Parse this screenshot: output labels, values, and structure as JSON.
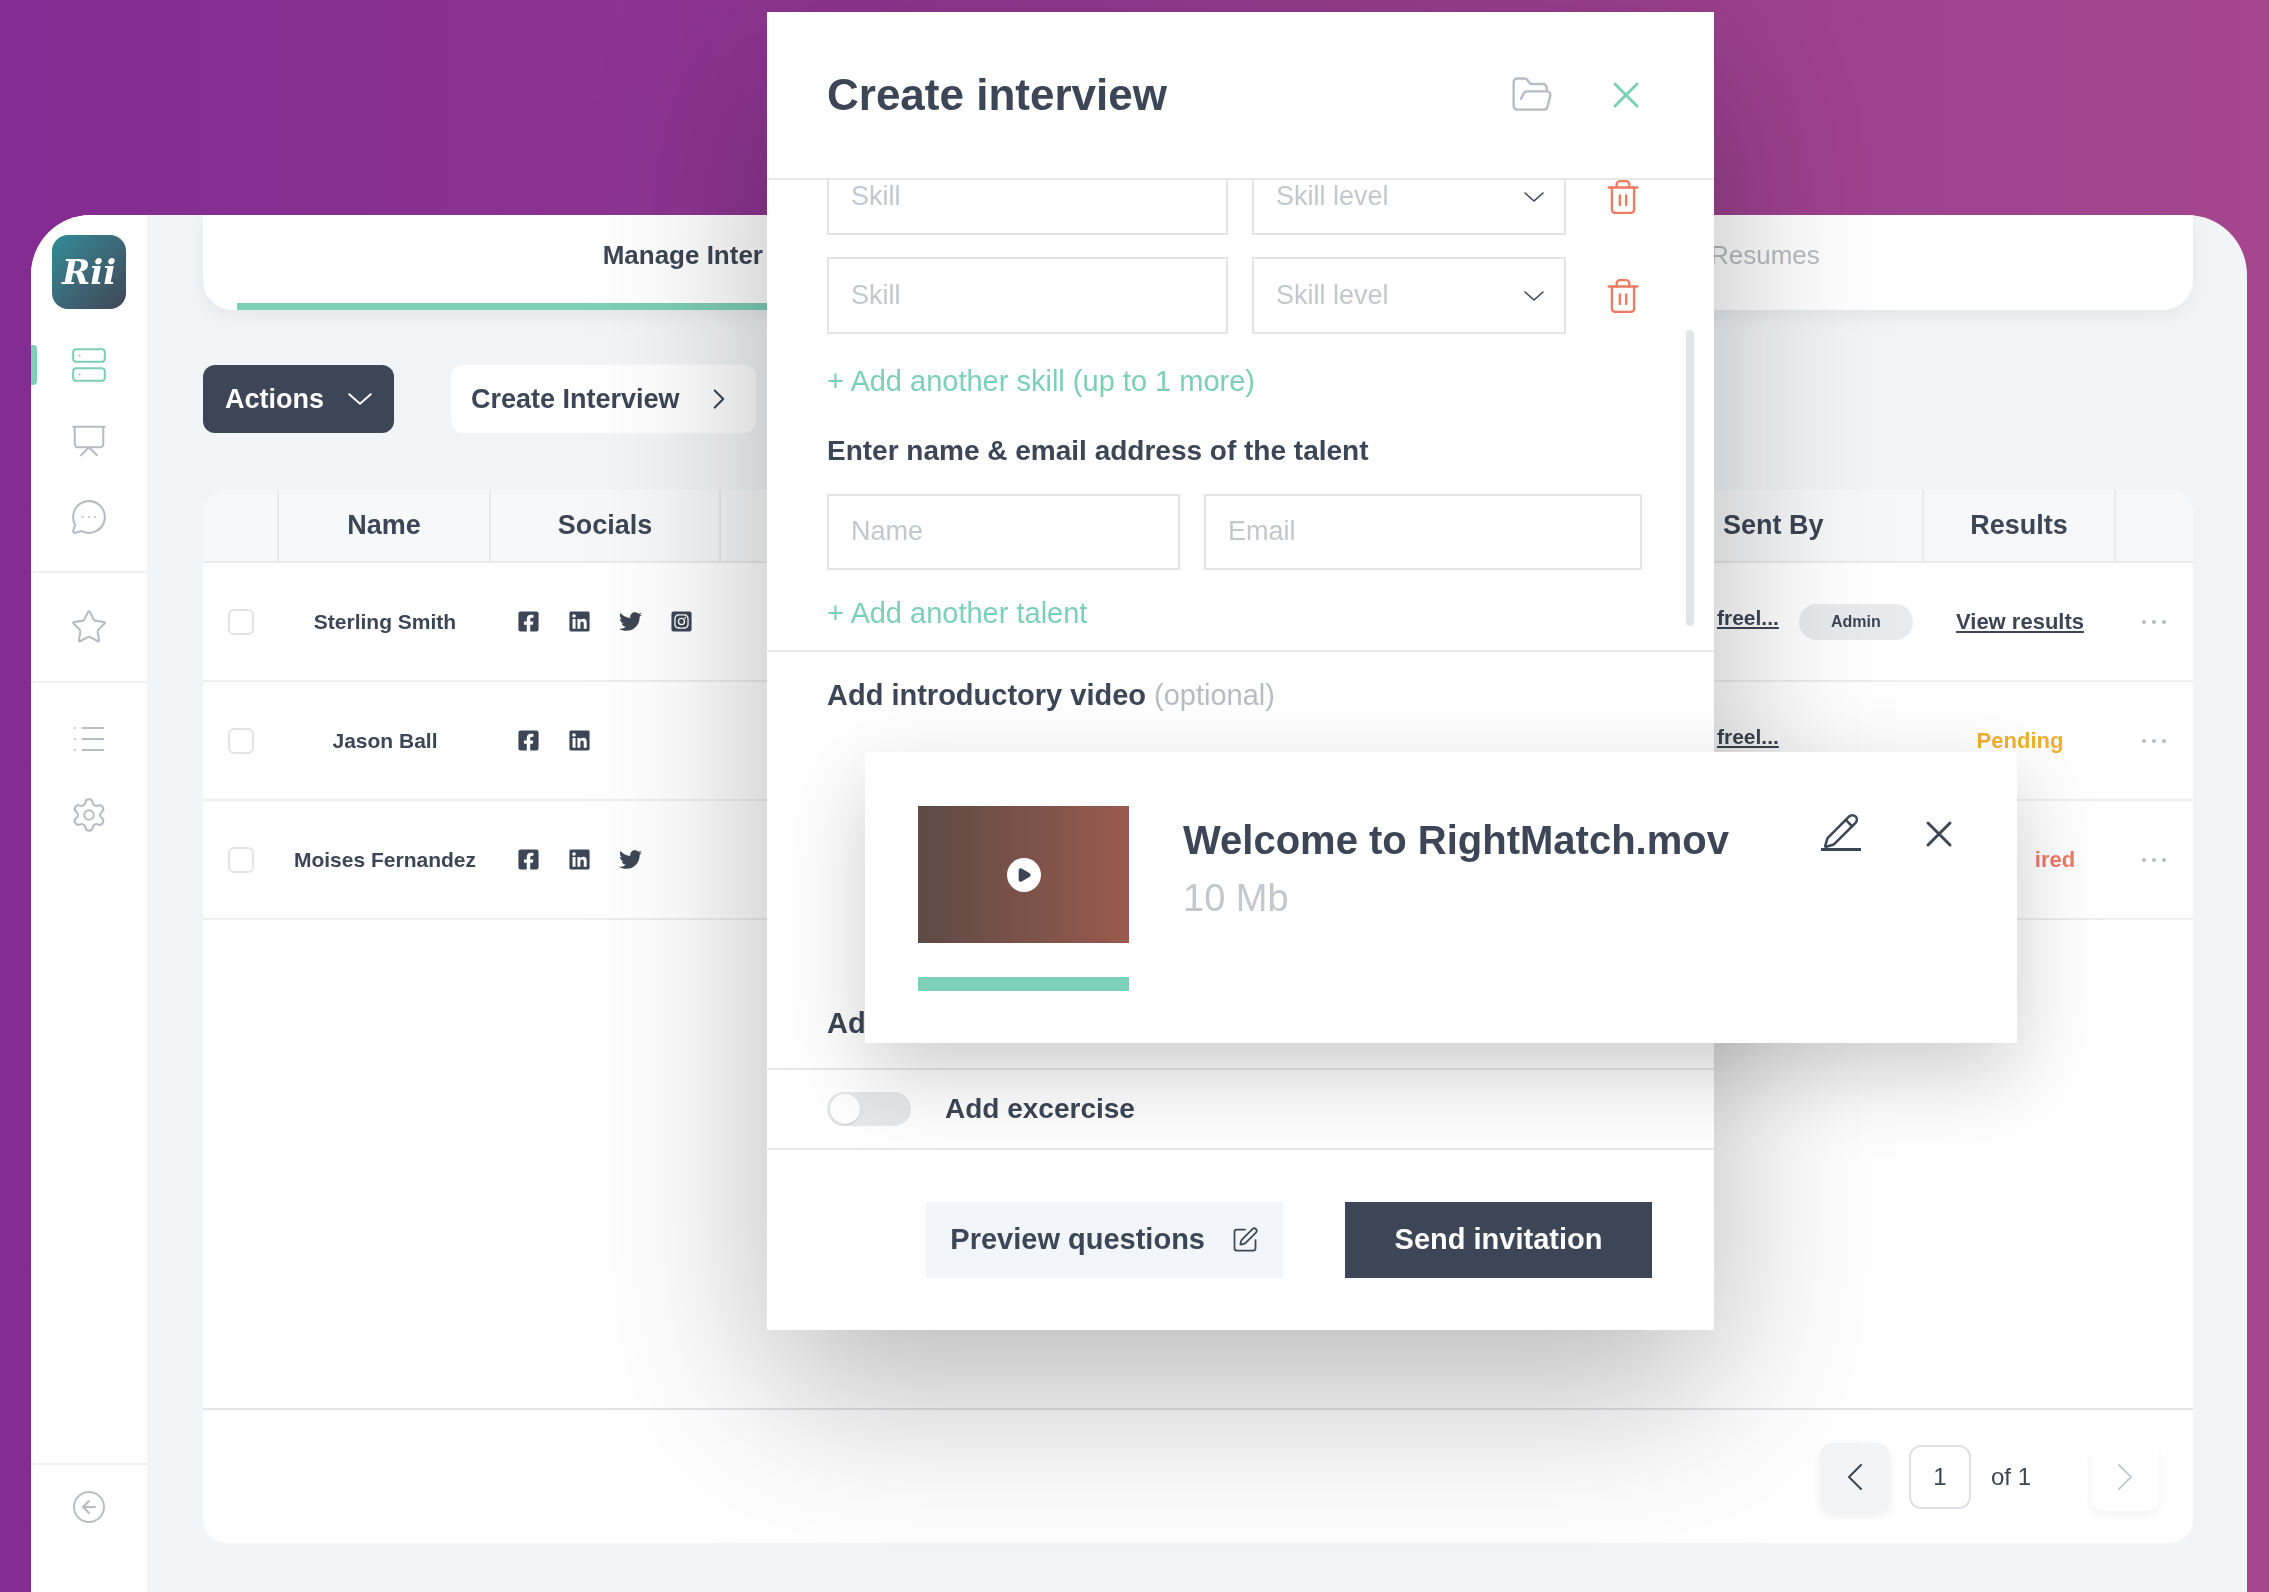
{
  "sidebar": {
    "items": [
      {
        "kind": "cabinet",
        "selected": true
      },
      {
        "kind": "presentation",
        "selected": false
      },
      {
        "kind": "chat",
        "selected": false
      },
      {
        "kind": "star",
        "selected": false
      },
      {
        "kind": "list",
        "selected": false
      },
      {
        "kind": "settings",
        "selected": false
      }
    ],
    "logo": "Rii"
  },
  "tabs": [
    {
      "label": "Manage Inter",
      "selected": true
    },
    {
      "label": "Resumes",
      "selected": false
    }
  ],
  "toolbar": {
    "actions": "Actions",
    "create": "Create Interview"
  },
  "table": {
    "columns": [
      "Name",
      "Socials",
      "Sent By",
      "Results"
    ],
    "rows": [
      {
        "checked": false,
        "name": "Sterling Smith",
        "socials": [
          {
            "kind": "facebook"
          },
          {
            "kind": "linkedin"
          },
          {
            "kind": "twitter"
          },
          {
            "kind": "instagram"
          }
        ],
        "sent_by": "freel...",
        "badge": "Admin",
        "result": {
          "kind": "link",
          "text": "View results"
        }
      },
      {
        "checked": false,
        "name": "Jason Ball",
        "socials": [
          {
            "kind": "facebook"
          },
          {
            "kind": "linkedin"
          }
        ],
        "sent_by": "freel...",
        "result": {
          "kind": "pending",
          "text": "Pending"
        }
      },
      {
        "checked": false,
        "name": "Moises Fernandez",
        "socials": [
          {
            "kind": "facebook"
          },
          {
            "kind": "linkedin"
          },
          {
            "kind": "twitter"
          }
        ],
        "result": {
          "kind": "expired",
          "text": "ired"
        }
      }
    ]
  },
  "pagination": {
    "page": "1",
    "total": "of 1",
    "next_disabled": true
  },
  "modal": {
    "title": "Create interview",
    "skills": [
      {
        "placeholder": "Skill",
        "level_placeholder": "Skill level"
      },
      {
        "placeholder": "Skill",
        "level_placeholder": "Skill level"
      }
    ],
    "add_skill": "+ Add another skill (up to 1 more)",
    "talent_heading": "Enter name & email address of the talent",
    "name_placeholder": "Name",
    "email_placeholder": "Email",
    "add_talent": "+ Add another talent",
    "video_heading": "Add introductory video",
    "video_note": "(optional)",
    "cut_heading": "Ad",
    "exercise": {
      "label": "Add excercise",
      "on": false
    },
    "preview": "Preview questions",
    "send": "Send invitation"
  },
  "video_card": {
    "filename": "Welcome to RightMatch.mov",
    "size": "10 Mb",
    "level": 1
  }
}
